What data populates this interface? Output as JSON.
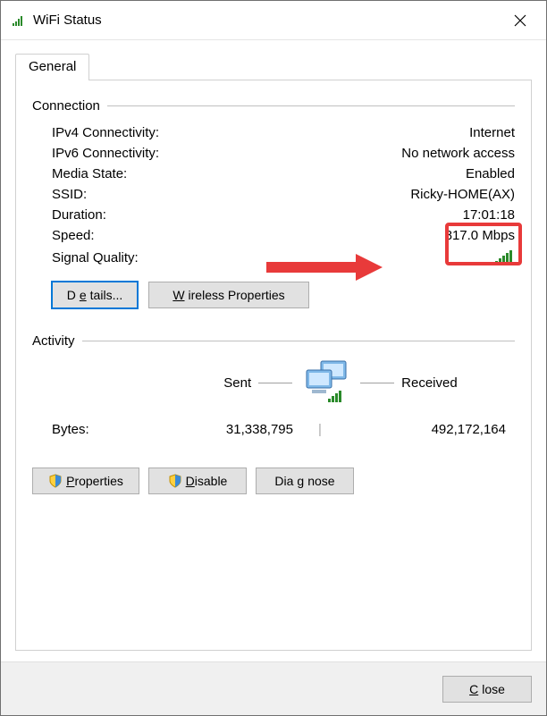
{
  "window": {
    "title": "WiFi Status"
  },
  "tab": {
    "general": "General"
  },
  "groups": {
    "connection": "Connection",
    "activity": "Activity"
  },
  "connection": {
    "ipv4_label": "IPv4 Connectivity:",
    "ipv4_value": "Internet",
    "ipv6_label": "IPv6 Connectivity:",
    "ipv6_value": "No network access",
    "media_label": "Media State:",
    "media_value": "Enabled",
    "ssid_label": "SSID:",
    "ssid_value": "Ricky-HOME(AX)",
    "duration_label": "Duration:",
    "duration_value": "17:01:18",
    "speed_label": "Speed:",
    "speed_value": "817.0 Mbps",
    "signal_label": "Signal Quality:"
  },
  "buttons": {
    "details_pre": "D",
    "details_u": "e",
    "details_post": "tails...",
    "wireless_u": "W",
    "wireless_post": "ireless Properties",
    "properties_u": "P",
    "properties_post": "roperties",
    "disable_u": "D",
    "disable_post": "isable",
    "diagnose_pre": "Dia",
    "diagnose_u": "g",
    "diagnose_post": "nose",
    "close_u": "C",
    "close_post": "lose"
  },
  "activity": {
    "sent_label": "Sent",
    "received_label": "Received",
    "bytes_label": "Bytes:",
    "bytes_sent": "31,338,795",
    "bytes_recv": "492,172,164"
  }
}
